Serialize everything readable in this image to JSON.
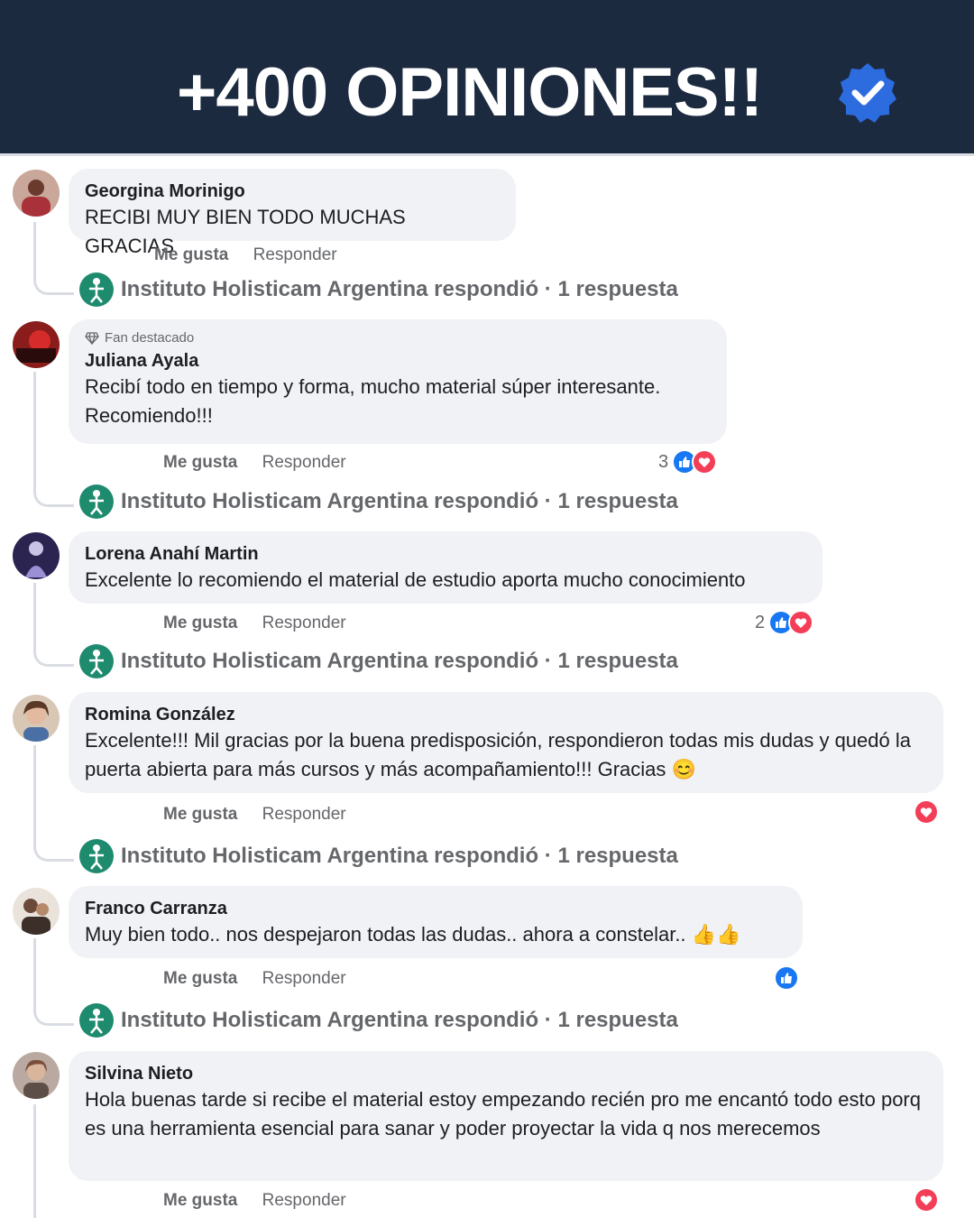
{
  "header": {
    "title": "+400 OPINIONES!!",
    "badge_icon": "verified-badge-icon",
    "background": "#1c2a40"
  },
  "labels": {
    "like": "Me gusta",
    "reply": "Responder"
  },
  "replies": {
    "text": "Instituto Holisticam Argentina respondió · 1 respuesta"
  },
  "comments": [
    {
      "author": "Georgina Morinigo",
      "text": "RECIBI MUY BIEN TODO MUCHAS GRACIAS"
    },
    {
      "badge": "Fan destacado",
      "author": "Juliana Ayala",
      "text": "Recibí todo en tiempo y forma, mucho material súper interesante. Recomiendo!!!",
      "reaction_count": "3"
    },
    {
      "author": "Lorena Anahí Martin",
      "text": "Excelente lo recomiendo el material de estudio aporta mucho conocimiento",
      "reaction_count": "2"
    },
    {
      "author": "Romina González",
      "text": "Excelente!!! Mil gracias por la buena predisposición, respondieron todas mis dudas y quedó la puerta abierta para más cursos y más acompañamiento!!! Gracias 😊"
    },
    {
      "author": "Franco Carranza",
      "text": "Muy bien todo.. nos despejaron todas las dudas.. ahora a constelar.. 👍👍"
    },
    {
      "author": "Silvina Nieto",
      "text": "Hola buenas tarde si recibe el material estoy empezando recién pro me encantó todo esto porq es una herramienta esencial para sanar y poder proyectar la vida q nos merecemos"
    }
  ],
  "colors": {
    "bubble": "#f0f2f5",
    "like": "#1877f2",
    "love": "#f33e58",
    "reply_avatar": "#1e8a6e"
  }
}
